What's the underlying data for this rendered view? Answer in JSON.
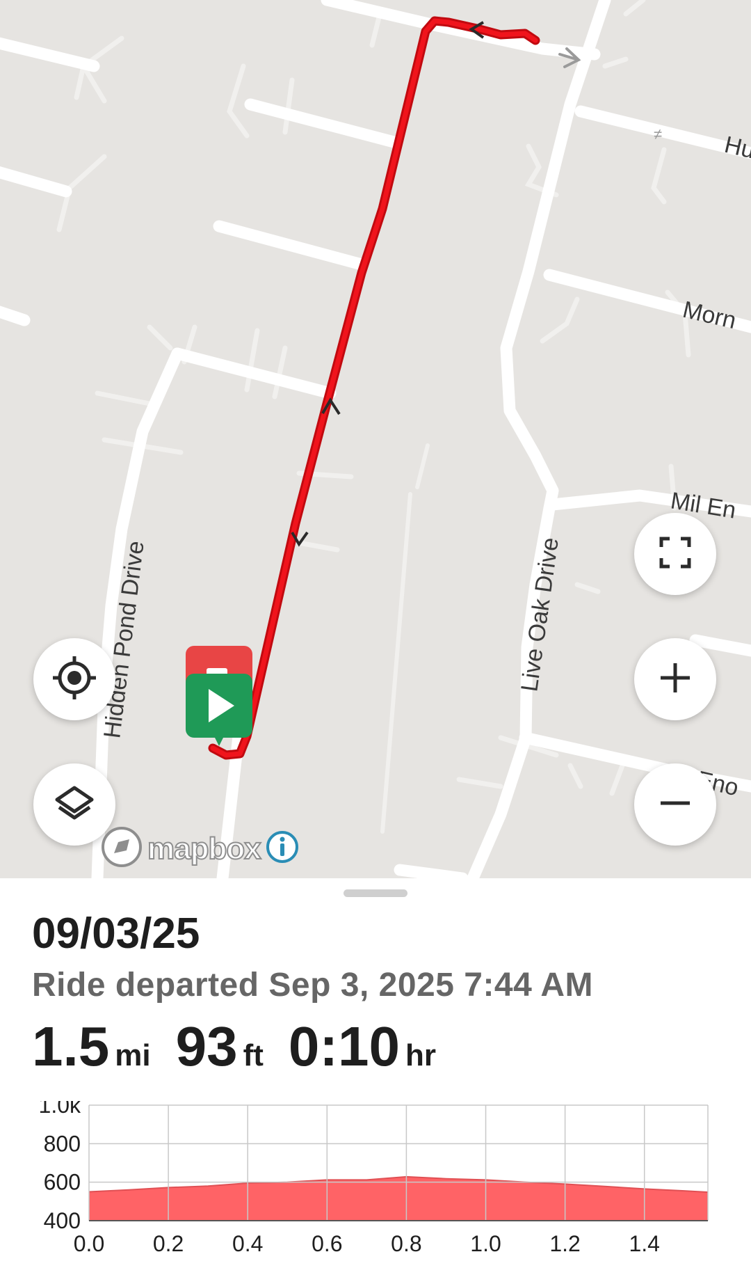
{
  "map": {
    "street_labels": {
      "hidden_pond": "Hidden Pond Drive",
      "live_oak": "Live Oak Drive",
      "hu": "Hu",
      "morn": "Morn",
      "mil_en": "Mil En",
      "eno": "Eno"
    },
    "attribution": "mapbox",
    "icons": {
      "locate": "crosshair-target-icon",
      "layers": "layers-icon",
      "fullscreen": "fullscreen-icon",
      "zoom_in": "plus-icon",
      "zoom_out": "minus-icon",
      "start": "play-icon",
      "end": "stop-icon",
      "info": "info-icon"
    },
    "route_color": "#e8141b"
  },
  "ride": {
    "title": "09/03/25",
    "subtitle": "Ride departed Sep 3, 2025 7:44 AM",
    "stats": [
      {
        "value": "1.5",
        "unit": "mi"
      },
      {
        "value": "93",
        "unit": "ft"
      },
      {
        "value": "0:10",
        "unit": "hr"
      }
    ]
  },
  "chart_data": {
    "type": "area",
    "title": "",
    "xlabel": "",
    "ylabel": "",
    "x_tick_labels": [
      "0.0",
      "0.2",
      "0.4",
      "0.6",
      "0.8",
      "1.0",
      "1.2",
      "1.4"
    ],
    "y_tick_labels": [
      "1.0k",
      "800",
      "600",
      "400"
    ],
    "xlim": [
      0,
      1.56
    ],
    "ylim": [
      400,
      1000
    ],
    "grid": true,
    "fill_color": "#ff6366",
    "line_color": "#e05054",
    "series": [
      {
        "x": [
          0.0,
          0.1,
          0.2,
          0.3,
          0.4,
          0.5,
          0.6,
          0.7,
          0.8,
          0.9,
          1.0,
          1.1,
          1.2,
          1.3,
          1.4,
          1.5,
          1.56
        ],
        "values": [
          550,
          560,
          572,
          580,
          595,
          600,
          612,
          612,
          628,
          618,
          612,
          600,
          590,
          578,
          565,
          555,
          548
        ]
      }
    ]
  }
}
